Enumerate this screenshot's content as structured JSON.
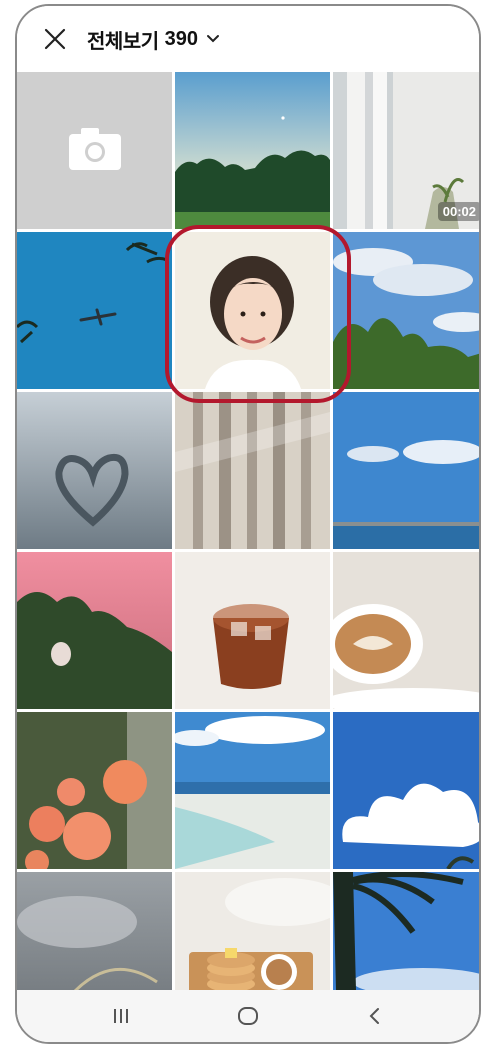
{
  "header": {
    "title": "전체보기",
    "count": "390",
    "close_icon": "close-icon",
    "dropdown_icon": "chevron-down-icon"
  },
  "grid": {
    "video_duration": "00:02",
    "camera_icon": "camera-icon"
  },
  "navbar": {
    "recent_icon": "recent-apps-icon",
    "home_icon": "home-icon",
    "back_icon": "back-icon"
  },
  "colors": {
    "highlight": "#b3182d",
    "camera_bg": "#cfcfcf",
    "navbar_bg": "#f6f6f6"
  }
}
